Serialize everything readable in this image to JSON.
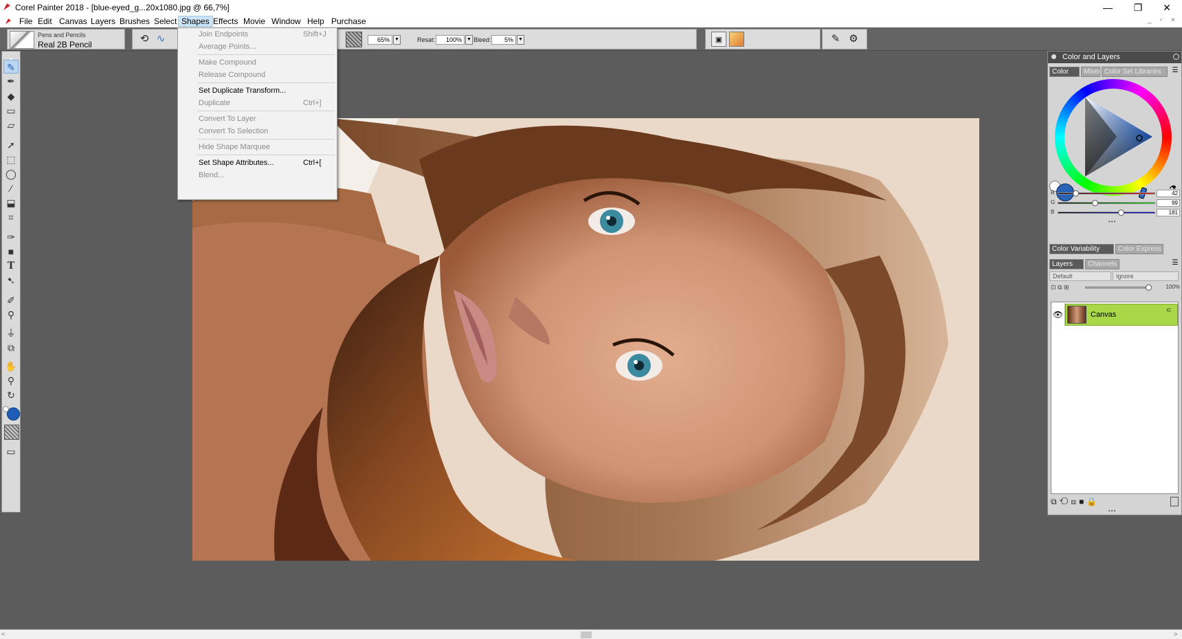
{
  "window": {
    "title": "Corel Painter 2018 - [blue-eyed_g...20x1080.jpg @ 66,7%]",
    "minimize_glyph": "—",
    "restore_glyph": "❐",
    "close_glyph": "✕"
  },
  "menubar": {
    "items": [
      "File",
      "Edit",
      "Canvas",
      "Layers",
      "Brushes",
      "Select",
      "Shapes",
      "Effects",
      "Movie",
      "Window",
      "Help",
      "Purchase"
    ],
    "active": "Shapes"
  },
  "propbar": {
    "brush_category": "Pens and Pencils",
    "brush_name": "Real 2B Pencil",
    "opacity_value": "65%",
    "resat_label": "Resat:",
    "resat_value": "100%",
    "bleed_label": "Bleed:",
    "bleed_value": "5%"
  },
  "shapes_menu": {
    "items": [
      {
        "label": "Join Endpoints",
        "shortcut": "Shift+J",
        "enabled": false
      },
      {
        "label": "Average Points...",
        "shortcut": "",
        "enabled": false
      },
      {
        "label": "Make Compound",
        "shortcut": "",
        "enabled": false
      },
      {
        "label": "Release Compound",
        "shortcut": "",
        "enabled": false
      },
      {
        "label": "Set Duplicate Transform...",
        "shortcut": "",
        "enabled": true
      },
      {
        "label": "Duplicate",
        "shortcut": "Ctrl+]",
        "enabled": false
      },
      {
        "label": "Convert To Layer",
        "shortcut": "",
        "enabled": false
      },
      {
        "label": "Convert To Selection",
        "shortcut": "",
        "enabled": false
      },
      {
        "label": "Hide Shape Marquee",
        "shortcut": "",
        "enabled": false
      },
      {
        "label": "Set Shape Attributes...",
        "shortcut": "Ctrl+[",
        "enabled": true
      },
      {
        "label": "Blend...",
        "shortcut": "",
        "enabled": false
      }
    ]
  },
  "right_panel": {
    "title": "Color and Layers",
    "color_tabs": [
      "Color",
      "Mixer",
      "Color Set Libraries"
    ],
    "rgb": {
      "r_label": "R",
      "g_label": "G",
      "b_label": "B",
      "r": "42",
      "g": "99",
      "b": "181"
    },
    "current_color": "#2a63b5",
    "variability_tabs": [
      "Color Variability",
      "Color Express"
    ],
    "layer_tabs": [
      "Layers",
      "Channels"
    ],
    "composite_method": "Default",
    "composite_depth": "Ignore",
    "layer_opacity": "100%",
    "layers": [
      {
        "name": "Canvas"
      }
    ]
  }
}
